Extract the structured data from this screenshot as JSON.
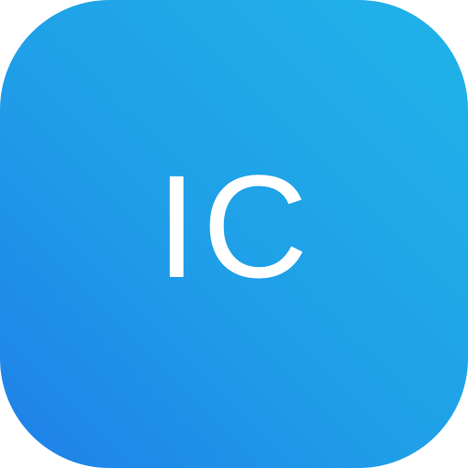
{
  "icon": {
    "label": "IC",
    "colors": {
      "gradient_top_right": "#20b3e8",
      "gradient_mid": "#1f9fe8",
      "gradient_bottom_left": "#1f7fe8",
      "label_color": "#ffffff"
    }
  }
}
